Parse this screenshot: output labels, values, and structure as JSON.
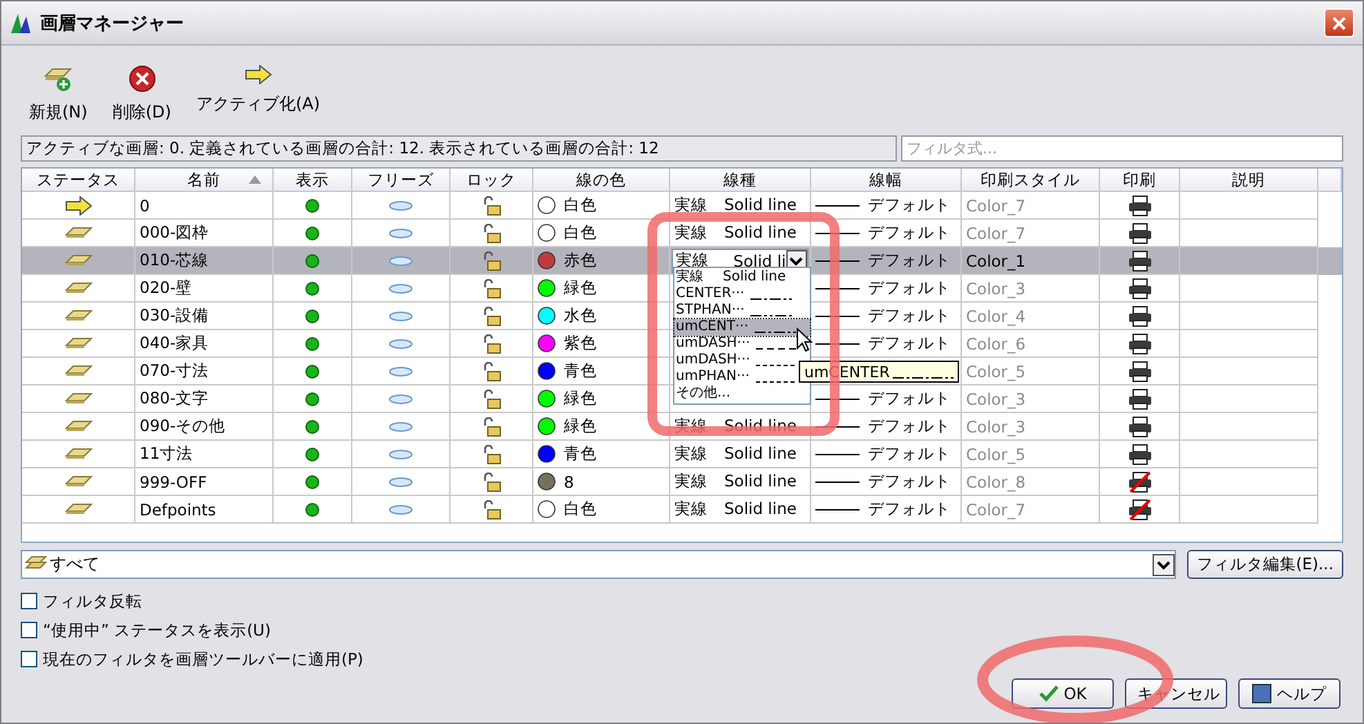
{
  "window": {
    "title": "画層マネージャー"
  },
  "toolbar": [
    {
      "kind": "new",
      "label": "新規(N)"
    },
    {
      "kind": "delete",
      "label": "削除(D)"
    },
    {
      "kind": "current",
      "label": "アクティブ化(A)"
    }
  ],
  "info": {
    "text": "アクティブな画層: 0. 定義されている画層の合計: 12. 表示されている画層の合計: 12",
    "filter_placeholder": "フィルタ式..."
  },
  "table": {
    "columns": [
      {
        "label": "ステータス",
        "sorted": false
      },
      {
        "label": "名前",
        "sorted": true
      },
      {
        "label": "表示",
        "sorted": false
      },
      {
        "label": "フリーズ",
        "sorted": false
      },
      {
        "label": "ロック",
        "sorted": false
      },
      {
        "label": "線の色",
        "sorted": false
      },
      {
        "label": "線種",
        "sorted": false
      },
      {
        "label": "線幅",
        "sorted": false
      },
      {
        "label": "印刷スタイル",
        "sorted": false
      },
      {
        "label": "印刷",
        "sorted": false
      },
      {
        "label": "説明",
        "sorted": false
      }
    ],
    "rows": [
      {
        "kind": "current",
        "name": "0",
        "on": true,
        "frozen": false,
        "locked": false,
        "color": "#ffffff",
        "color_name": "白色",
        "linetype": "実線",
        "linetype_en": "Solid line",
        "lineweight": "デフォルト",
        "plot_style": "Color_7",
        "plot": true,
        "selected": false
      },
      {
        "kind": "layer",
        "name": "000-図枠",
        "on": true,
        "frozen": false,
        "locked": false,
        "color": "#ffffff",
        "color_name": "白色",
        "linetype": "実線",
        "linetype_en": "Solid line",
        "lineweight": "デフォルト",
        "plot_style": "Color_7",
        "plot": true,
        "selected": false
      },
      {
        "kind": "layer",
        "name": "010-芯線",
        "on": true,
        "frozen": false,
        "locked": false,
        "color": "#c0393f",
        "color_name": "赤色",
        "linetype": "実線",
        "linetype_en": "Solid li",
        "lineweight": "デフォルト",
        "plot_style": "Color_1",
        "plot": true,
        "selected": true,
        "linetype_dropdown": {
          "items": [
            {
              "label": "実線",
              "label_en": "Solid line",
              "kind": "solid",
              "selected": false
            },
            {
              "label": "CENTER···",
              "kind": "center",
              "selected": false
            },
            {
              "label": "STPHAN···",
              "kind": "phantom",
              "selected": false
            },
            {
              "label": "umCENT···",
              "kind": "center",
              "selected": true
            },
            {
              "label": "umDASH···",
              "kind": "dashed",
              "selected": false
            },
            {
              "label": "umDASH···",
              "kind": "hidden",
              "selected": false
            },
            {
              "label": "umPHAN···",
              "kind": "hidden",
              "selected": false
            },
            {
              "label": "その他...",
              "kind": "other",
              "selected": false
            }
          ],
          "tooltip": "umCENTER"
        }
      },
      {
        "kind": "layer",
        "name": "020-壁",
        "on": true,
        "frozen": false,
        "locked": false,
        "color": "#00ff00",
        "color_name": "緑色",
        "lineweight": "デフォルト",
        "plot_style": "Color_3",
        "plot": true,
        "selected": false
      },
      {
        "kind": "layer",
        "name": "030-設備",
        "on": true,
        "frozen": false,
        "locked": false,
        "color": "#00ffff",
        "color_name": "水色",
        "lineweight": "デフォルト",
        "plot_style": "Color_4",
        "plot": true,
        "selected": false
      },
      {
        "kind": "layer",
        "name": "040-家具",
        "on": true,
        "frozen": false,
        "locked": false,
        "color": "#ff00ff",
        "color_name": "紫色",
        "lineweight": "デフォルト",
        "plot_style": "Color_6",
        "plot": true,
        "selected": false
      },
      {
        "kind": "layer",
        "name": "070-寸法",
        "on": true,
        "frozen": false,
        "locked": false,
        "color": "#0000ff",
        "color_name": "青色",
        "plot_style": "Color_5",
        "plot": true,
        "selected": false
      },
      {
        "kind": "layer",
        "name": "080-文字",
        "on": true,
        "frozen": false,
        "locked": false,
        "color": "#00ff00",
        "color_name": "緑色",
        "lineweight": "デフォルト",
        "plot_style": "Color_3",
        "plot": true,
        "selected": false
      },
      {
        "kind": "layer",
        "name": "090-その他",
        "on": true,
        "frozen": false,
        "locked": false,
        "color": "#00ff00",
        "color_name": "緑色",
        "linetype": "実線",
        "linetype_en": "Solid line",
        "lineweight": "デフォルト",
        "plot_style": "Color_3",
        "plot": true,
        "selected": false
      },
      {
        "kind": "layer",
        "name": "11寸法",
        "on": true,
        "frozen": false,
        "locked": false,
        "color": "#0000ff",
        "color_name": "青色",
        "linetype": "実線",
        "linetype_en": "Solid line",
        "lineweight": "デフォルト",
        "plot_style": "Color_5",
        "plot": true,
        "selected": false
      },
      {
        "kind": "layer",
        "name": "999-OFF",
        "on": true,
        "frozen": false,
        "locked": false,
        "color": "#77705e",
        "color_name": "8",
        "linetype": "実線",
        "linetype_en": "Solid line",
        "lineweight": "デフォルト",
        "plot_style": "Color_8",
        "plot": false,
        "selected": false
      },
      {
        "kind": "layer",
        "name": "Defpoints",
        "on": true,
        "frozen": false,
        "locked": false,
        "color": "#ffffff",
        "color_name": "白色",
        "linetype": "実線",
        "linetype_en": "Solid line",
        "lineweight": "デフォルト",
        "plot_style": "Color_7",
        "plot": false,
        "selected": false
      }
    ]
  },
  "filter": {
    "value": "すべて",
    "edit_button": "フィルタ編集(E)..."
  },
  "options": [
    {
      "label": "フィルタ反転",
      "checked": false
    },
    {
      "label": "“使用中” ステータスを表示(U)",
      "checked": false
    },
    {
      "label": "現在のフィルタを画層ツールバーに適用(P)",
      "checked": false
    }
  ],
  "buttons": [
    {
      "kind": "ok",
      "label": "OK"
    },
    {
      "kind": "cancel",
      "label": "キャンセル"
    },
    {
      "kind": "help",
      "label": "ヘルプ"
    }
  ]
}
